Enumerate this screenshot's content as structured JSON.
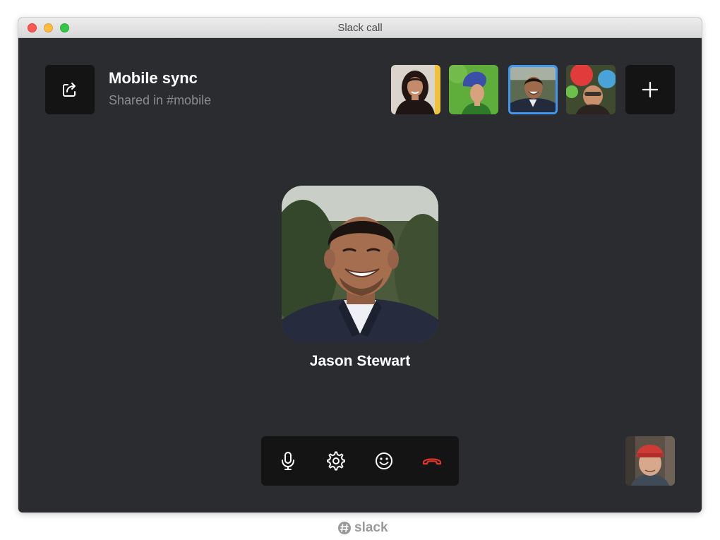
{
  "window": {
    "title": "Slack call"
  },
  "call": {
    "name": "Mobile sync",
    "channel": "Shared in #mobile"
  },
  "participants": [
    {
      "id": "participant-1",
      "active": false,
      "icon": "user-avatar"
    },
    {
      "id": "participant-2",
      "active": false,
      "icon": "user-avatar"
    },
    {
      "id": "participant-3",
      "active": true,
      "icon": "user-avatar"
    },
    {
      "id": "participant-4",
      "active": false,
      "icon": "user-avatar"
    }
  ],
  "speaker": {
    "name": "Jason Stewart"
  },
  "controls": {
    "icons": [
      "microphone-icon",
      "gear-icon",
      "emoji-icon",
      "hang-up-icon"
    ]
  },
  "brand": {
    "label": "slack"
  },
  "colors": {
    "window_bg": "#2b2c30",
    "tile_bg": "#141414",
    "active_border": "#3f97f2",
    "hang_up": "#e0352b",
    "muted_text": "#8b8c90"
  }
}
